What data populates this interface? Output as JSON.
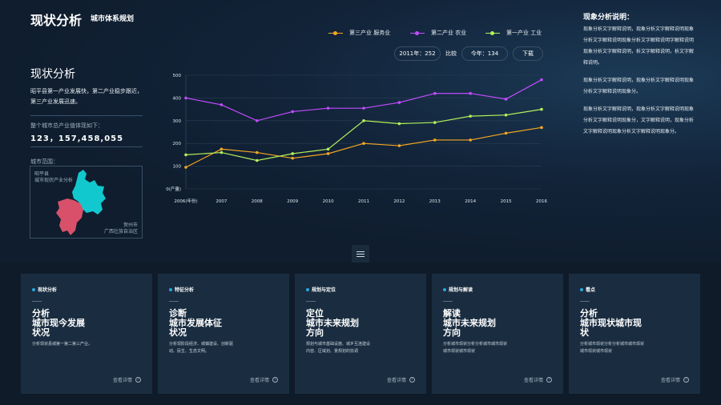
{
  "header": {
    "title": "现状分析",
    "subtitle": "城市体系规划"
  },
  "left": {
    "title": "现状分析",
    "desc": "昭平县第一产业发展快，第二产业稳步跟近，第三产业发展迅速。",
    "total_label": "整个城市总产业值体现如下：",
    "total_value": "123，157,458,055",
    "map_label": "城市范围：",
    "map_t1": "昭平县",
    "map_t2": "城市现状产业分析",
    "map_t3": "贺州市",
    "map_t4": "广西壮族自治区",
    "colors": {
      "cyan": "#12c8cf",
      "red": "#d8506a"
    }
  },
  "legend": [
    {
      "label": "第三产业   服务业",
      "color": "#f5a623"
    },
    {
      "label": "第二产业   农业",
      "color": "#c24bff"
    },
    {
      "label": "第一产业   工业",
      "color": "#b4f05a"
    }
  ],
  "controls": {
    "year": "2011年：252",
    "compare": "比较",
    "today": "今年：134",
    "download": "下载"
  },
  "chart_data": {
    "type": "line",
    "x": [
      "2006(年份)",
      "2007",
      "2008",
      "2009",
      "2010",
      "2011",
      "2012",
      "2013",
      "2014",
      "2015",
      "2016"
    ],
    "y_ticks": [
      "0(产量)",
      "100",
      "200",
      "300",
      "400",
      "500"
    ],
    "ylim": [
      0,
      500
    ],
    "grid": true,
    "series": [
      {
        "name": "第三产业   服务业",
        "color": "#f5a623",
        "values": [
          95,
          175,
          160,
          135,
          155,
          200,
          190,
          215,
          215,
          245,
          270
        ]
      },
      {
        "name": "第二产业   农业",
        "color": "#c24bff",
        "values": [
          400,
          370,
          300,
          340,
          355,
          355,
          380,
          420,
          420,
          395,
          480
        ]
      },
      {
        "name": "第一产业   工业",
        "color": "#b4f05a",
        "values": [
          150,
          160,
          125,
          155,
          175,
          300,
          287,
          292,
          320,
          325,
          350
        ]
      }
    ]
  },
  "right": {
    "title": "现象分析说明：",
    "p1": "现象分析文字解释说明，现象分析文字解释说明现象分析文字解释说明现象分析文字解释说明字解释说明现象分析文字解释说明，析文字解释说明，析文字解释说明。",
    "p2": "现象分析文字解释说明，现象分析文字解释说明现象分析文字解释说明现象分。",
    "p3": "现象分析文字解释说明，现象分析文字解释说明现象分析文字解释说明现象分，文字解释说明，现象分析文字解释说明现象分析文字解释说明现象分。"
  },
  "cards": [
    {
      "tag": "现状分析",
      "lines": [
        "分析",
        "城市现今发展",
        "状况"
      ],
      "desc": "分析现状县城第一第二第三产业。",
      "more": "查看详情"
    },
    {
      "tag": "特征分析",
      "lines": [
        "诊断",
        "城市发展体征",
        "状况"
      ],
      "desc": "分析现阶段经济、城镇建设、创新驱动、民生、生态文明。",
      "more": "查看详情"
    },
    {
      "tag": "规划与定位",
      "lines": [
        "定位",
        "城市未来规划",
        "方向"
      ],
      "desc": "规划与城市基础设施、城乡互连建设内容、区域划、景规划的协调",
      "more": "查看详情"
    },
    {
      "tag": "规划与解读",
      "lines": [
        "解读",
        "城市未来规划",
        "方向"
      ],
      "desc": "分析城市现状分析分析城市城市现状城市现状城市现状",
      "more": "查看详情"
    },
    {
      "tag": "看点",
      "lines": [
        "分析",
        "城市现状城市现",
        "状"
      ],
      "desc": "分析城市现状分析分析城市城市现状城市现状城市现状",
      "more": "查看详情"
    }
  ]
}
